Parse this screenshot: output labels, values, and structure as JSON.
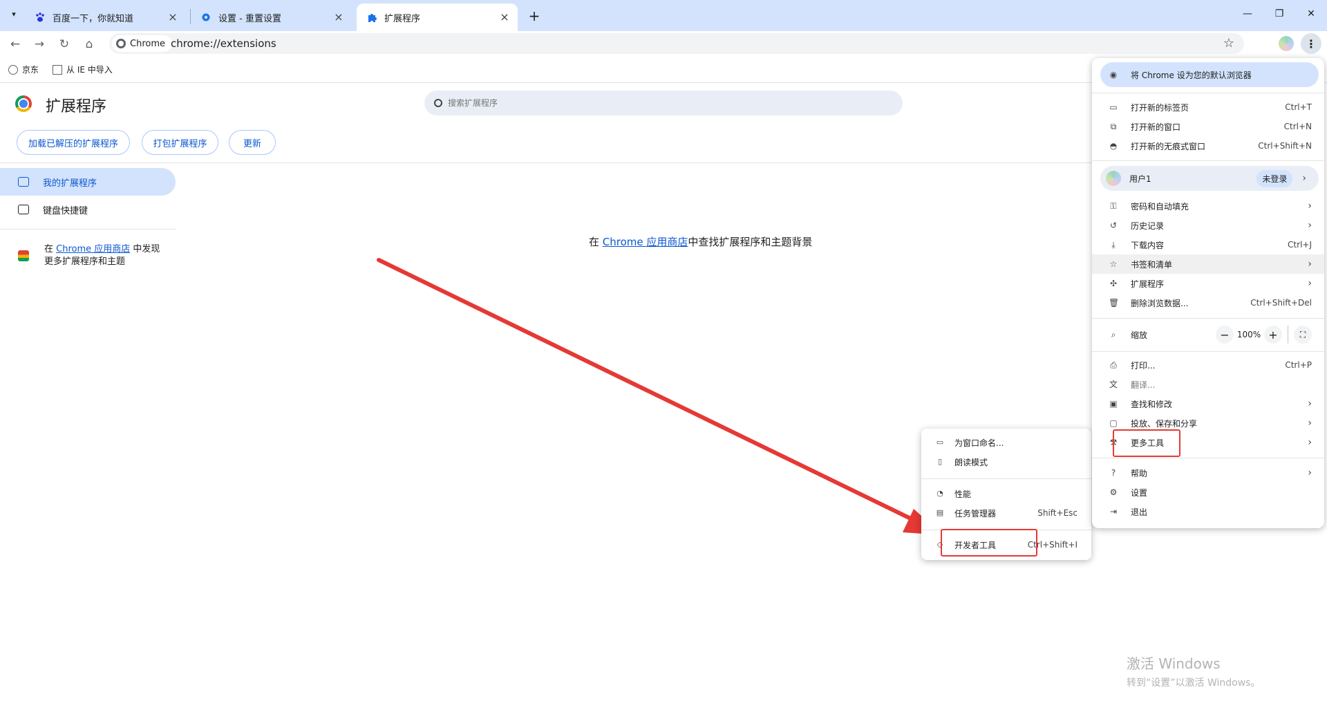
{
  "tabs": [
    {
      "label": "百度一下，你就知道",
      "icon": "baidu-paw-icon",
      "active": false
    },
    {
      "label": "设置 - 重置设置",
      "icon": "settings-gear-icon",
      "active": false
    },
    {
      "label": "扩展程序",
      "icon": "puzzle-icon",
      "active": true
    }
  ],
  "address": {
    "chip": "Chrome",
    "url": "chrome://extensions"
  },
  "bookmarks": [
    {
      "label": "京东",
      "icon": "globe-icon"
    },
    {
      "label": "从 IE 中导入",
      "icon": "folder-icon"
    }
  ],
  "extensions": {
    "title": "扩展程序",
    "search_placeholder": "搜索扩展程序",
    "buttons": {
      "load_unpacked": "加载已解压的扩展程序",
      "pack": "打包扩展程序",
      "update": "更新"
    },
    "sidebar": {
      "my_extensions": "我的扩展程序",
      "shortcuts": "键盘快捷键",
      "store_prefix": "在 ",
      "store_link": "Chrome 应用商店",
      "store_suffix": " 中发现更多扩展程序和主题"
    },
    "center": {
      "prefix": "在 ",
      "link": "Chrome 应用商店",
      "suffix": "中查找扩展程序和主题背景"
    }
  },
  "menu": {
    "default_browser": "将 Chrome 设为您的默认浏览器",
    "new_tab": {
      "label": "打开新的标签页",
      "shortcut": "Ctrl+T"
    },
    "new_window": {
      "label": "打开新的窗口",
      "shortcut": "Ctrl+N"
    },
    "incognito": {
      "label": "打开新的无痕式窗口",
      "shortcut": "Ctrl+Shift+N"
    },
    "profile": {
      "name": "用户1",
      "status": "未登录"
    },
    "passwords": {
      "label": "密码和自动填充"
    },
    "history": {
      "label": "历史记录"
    },
    "downloads": {
      "label": "下载内容",
      "shortcut": "Ctrl+J"
    },
    "bookmarks": {
      "label": "书签和清单"
    },
    "extensions": {
      "label": "扩展程序"
    },
    "clear_data": {
      "label": "删除浏览数据...",
      "shortcut": "Ctrl+Shift+Del"
    },
    "zoom": {
      "label": "缩放",
      "minus": "−",
      "value": "100%",
      "plus": "+"
    },
    "print": {
      "label": "打印...",
      "shortcut": "Ctrl+P"
    },
    "translate": {
      "label": "翻译..."
    },
    "find": {
      "label": "查找和修改"
    },
    "cast": {
      "label": "投放、保存和分享"
    },
    "more_tools": {
      "label": "更多工具"
    },
    "help": {
      "label": "帮助"
    },
    "settings": {
      "label": "设置"
    },
    "exit": {
      "label": "退出"
    }
  },
  "submenu": {
    "name_window": {
      "label": "为窗口命名..."
    },
    "reading_mode": {
      "label": "朗读模式"
    },
    "performance": {
      "label": "性能"
    },
    "task_manager": {
      "label": "任务管理器",
      "shortcut": "Shift+Esc"
    },
    "dev_tools": {
      "label": "开发者工具",
      "shortcut": "Ctrl+Shift+I"
    }
  },
  "watermark": {
    "line1": "激活 Windows",
    "line2": "转到“设置”以激活 Windows。"
  },
  "colors": {
    "accent": "#0b57d0",
    "tabstrip": "#d3e3fd",
    "annotation_red": "#e53935"
  }
}
